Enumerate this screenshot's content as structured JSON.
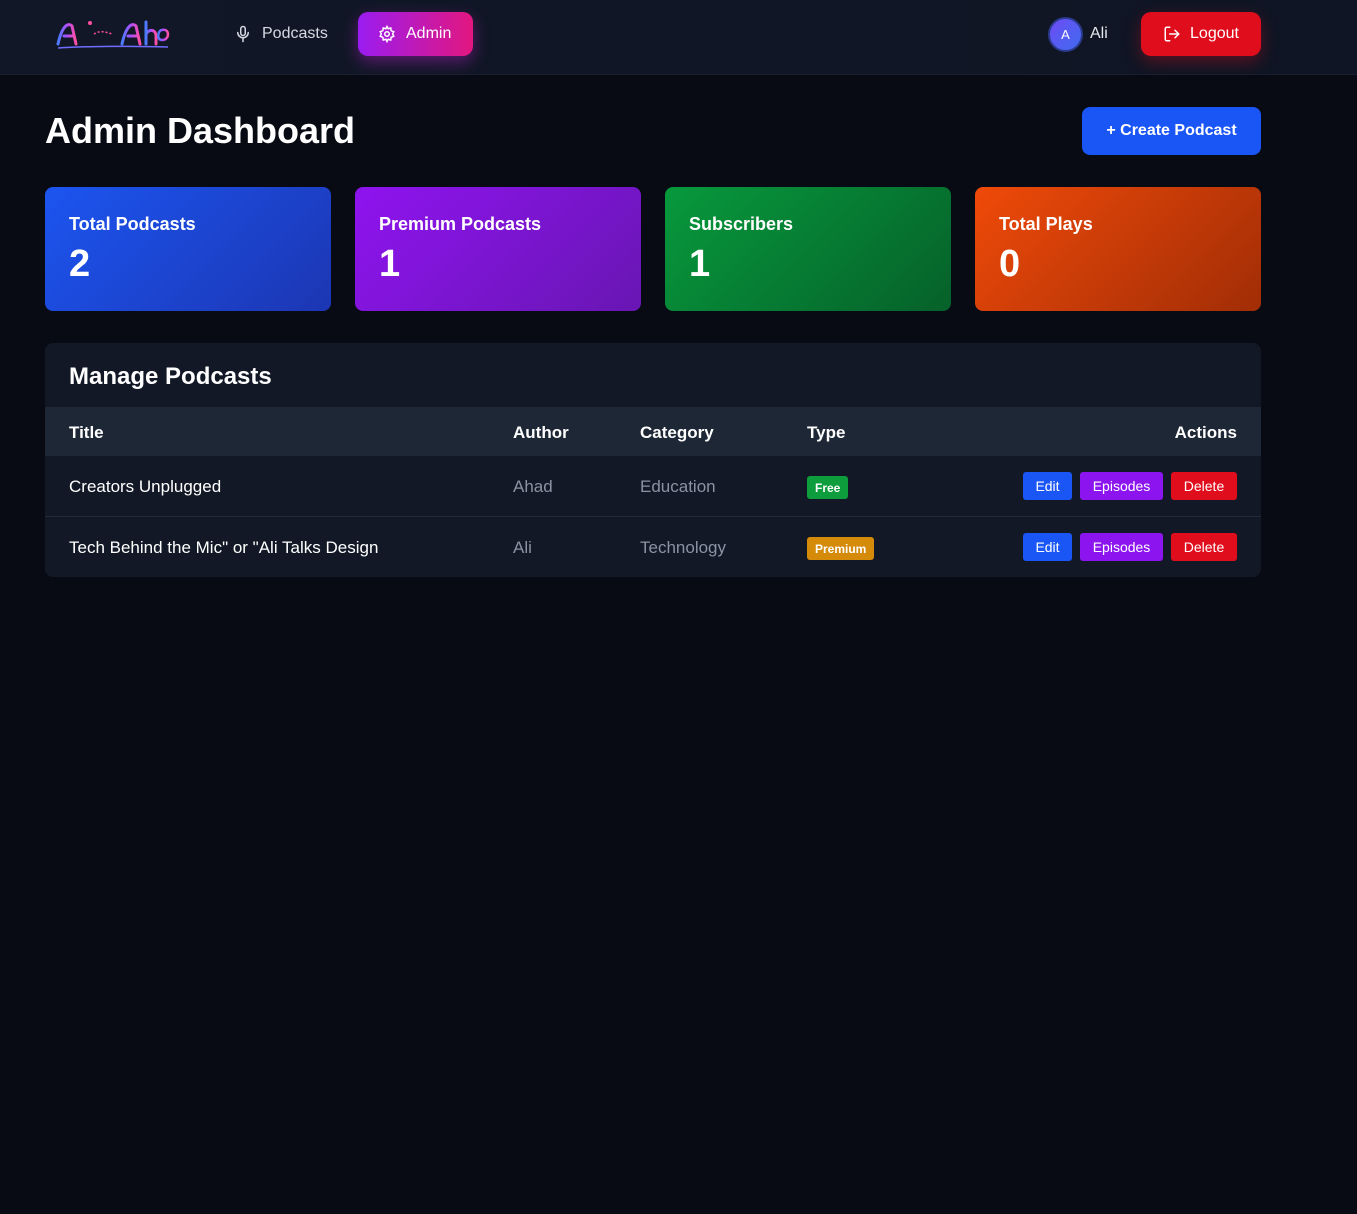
{
  "nav": {
    "logo_text": "Al Aho",
    "podcasts_label": "Podcasts",
    "admin_label": "Admin",
    "user_initial": "A",
    "user_name": "Ali",
    "logout_label": "Logout",
    "icons": {
      "podcasts": "microphone-icon",
      "admin": "gear-icon",
      "logout": "logout-icon"
    }
  },
  "page": {
    "title": "Admin Dashboard",
    "create_button": "+ Create Podcast"
  },
  "stats": [
    {
      "label": "Total Podcasts",
      "value": "2",
      "color": "#1c55f0"
    },
    {
      "label": "Premium Podcasts",
      "value": "1",
      "color": "#8f14ef"
    },
    {
      "label": "Subscribers",
      "value": "1",
      "color": "#07993c"
    },
    {
      "label": "Total Plays",
      "value": "0",
      "color": "#ef4a09"
    }
  ],
  "table": {
    "title": "Manage Podcasts",
    "headers": {
      "title": "Title",
      "author": "Author",
      "category": "Category",
      "type": "Type",
      "actions": "Actions"
    },
    "rows": [
      {
        "title": "Creators Unplugged",
        "author": "Ahad",
        "category": "Education",
        "type": "Free",
        "actions": {
          "edit": "Edit",
          "episodes": "Episodes",
          "delete": "Delete"
        }
      },
      {
        "title": "Tech Behind the Mic\" or \"Ali Talks Design",
        "author": "Ali",
        "category": "Technology",
        "type": "Premium",
        "actions": {
          "edit": "Edit",
          "episodes": "Episodes",
          "delete": "Delete"
        }
      }
    ]
  },
  "colors": {
    "background": "#080b14",
    "accent_blue": "#1a55f5",
    "accent_purple": "#8c14ef",
    "danger": "#e00d1d",
    "badge_free": "#0e9d3d",
    "badge_premium": "#d58a0a"
  }
}
